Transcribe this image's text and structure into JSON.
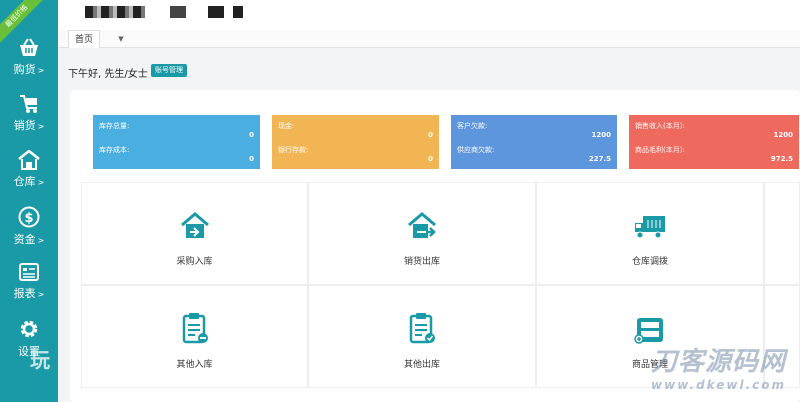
{
  "sidebar": {
    "ribbon": "最低价格",
    "items": [
      {
        "label": "购货",
        "icon": "basket-icon"
      },
      {
        "label": "销货",
        "icon": "cart-icon"
      },
      {
        "label": "仓库",
        "icon": "warehouse-icon"
      },
      {
        "label": "资金",
        "icon": "dollar-icon"
      },
      {
        "label": "报表",
        "icon": "report-icon"
      },
      {
        "label": "设置",
        "icon": "gear-icon"
      }
    ],
    "arrow": ">",
    "watermark": "玩"
  },
  "tabs": [
    {
      "label": "首页"
    }
  ],
  "tab_dropdown": "▼",
  "greeting": "下午好, 先生/女士",
  "account_button": "账号管理",
  "stats": [
    {
      "color": "#4aaee0",
      "rows": [
        {
          "label": "库存总量:",
          "value": "0"
        },
        {
          "label": "库存成本:",
          "value": "0"
        }
      ]
    },
    {
      "color": "#f2b553",
      "rows": [
        {
          "label": "现金:",
          "value": "0"
        },
        {
          "label": "银行存款:",
          "value": "0"
        }
      ]
    },
    {
      "color": "#5d96dc",
      "rows": [
        {
          "label": "客户欠款:",
          "value": "1200"
        },
        {
          "label": "供应商欠款:",
          "value": "227.5"
        }
      ]
    },
    {
      "color": "#ee6a5f",
      "rows": [
        {
          "label": "销售收入(本月):",
          "value": "1200"
        },
        {
          "label": "商品毛利(本月):",
          "value": "972.5"
        }
      ]
    }
  ],
  "tiles": [
    {
      "label": "采购入库",
      "icon": "house-in-icon"
    },
    {
      "label": "销货出库",
      "icon": "house-out-icon"
    },
    {
      "label": "仓库调拨",
      "icon": "truck-icon"
    },
    {
      "label": "其他入库",
      "icon": "clipboard-in-icon"
    },
    {
      "label": "其他出库",
      "icon": "clipboard-out-icon"
    },
    {
      "label": "商品管理",
      "icon": "box-icon"
    }
  ],
  "watermark": {
    "title": "刀客源码网",
    "url": "www.dkewl.com"
  },
  "colors": {
    "sidebar": "#1a9aa6",
    "accent": "#1a9aa6",
    "icon": "#1a9aa6"
  }
}
